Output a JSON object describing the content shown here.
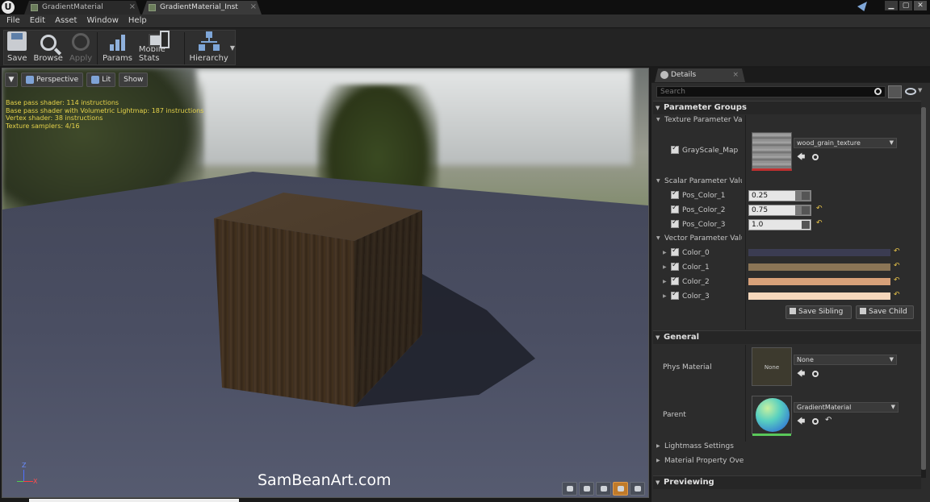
{
  "window": {
    "tabs": [
      {
        "label": "GradientMaterial",
        "close": "×"
      },
      {
        "label": "GradientMaterial_Inst",
        "close": "×"
      }
    ],
    "controls": {
      "minimize": "▁",
      "maximize": "▢",
      "close": "✕"
    }
  },
  "menu": [
    "File",
    "Edit",
    "Asset",
    "Window",
    "Help"
  ],
  "toolbar": {
    "save": "Save",
    "browse": "Browse",
    "apply": "Apply",
    "params": "Params",
    "mobile_stats": "Mobile Stats",
    "hierarchy": "Hierarchy",
    "hierarchy_caret": "▼"
  },
  "viewport": {
    "menu_caret": "▼",
    "perspective": "Perspective",
    "lit": "Lit",
    "show": "Show",
    "stats": [
      "Base pass shader: 114 instructions",
      "Base pass shader with Volumetric Lightmap: 187 instructions",
      "Vertex shader: 38 instructions",
      "Texture samplers: 4/16"
    ],
    "watermark": "SamBeanArt.com",
    "axis_z": "Z",
    "axis_x": "X"
  },
  "details": {
    "tab_label": "Details",
    "tab_close": "×",
    "search_placeholder": "Search",
    "parameter_groups": "Parameter Groups",
    "texture_group": "Texture Parameter Values",
    "texture_param": {
      "name": "GrayScale_Map",
      "value": "wood_grain_texture"
    },
    "scalar_group": "Scalar Parameter Values",
    "scalars": [
      {
        "name": "Pos_Color_1",
        "value": "0.25"
      },
      {
        "name": "Pos_Color_2",
        "value": "0.75"
      },
      {
        "name": "Pos_Color_3",
        "value": "1.0"
      }
    ],
    "vector_group": "Vector Parameter Values",
    "vectors": [
      {
        "name": "Color_0",
        "color": "#3b3c52"
      },
      {
        "name": "Color_1",
        "color": "#8b7556"
      },
      {
        "name": "Color_2",
        "color": "#d8a179"
      },
      {
        "name": "Color_3",
        "color": "#f6d7bb"
      }
    ],
    "save_sibling": "Save Sibling",
    "save_child": "Save Child",
    "general": "General",
    "phys_material_label": "Phys Material",
    "phys_material_value": "None",
    "phys_thumb_text": "None",
    "parent_label": "Parent",
    "parent_value": "GradientMaterial",
    "lightmass": "Lightmass Settings",
    "material_override": "Material Property Overrid",
    "previewing": "Previewing",
    "reset_symbol": "↶",
    "use_symbol": "🡄"
  }
}
